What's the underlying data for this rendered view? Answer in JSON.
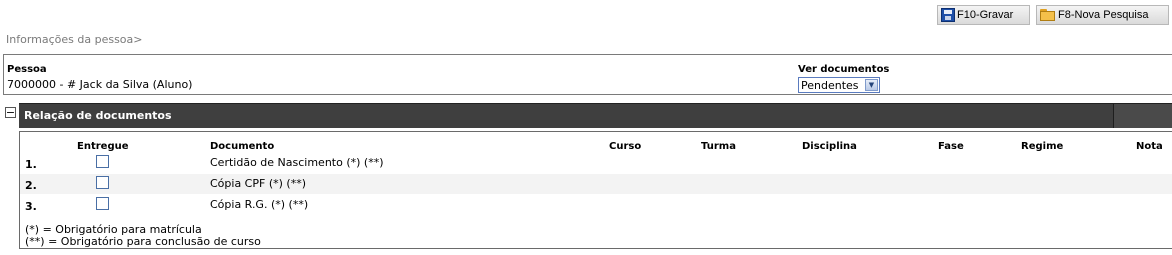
{
  "toolbar": {
    "save_label": "F10-Gravar",
    "search_label": "F8-Nova Pesquisa",
    "save_icon": "floppy-disk-icon",
    "search_icon": "folder-icon"
  },
  "breadcrumb": "Informações da pessoa>",
  "person": {
    "label": "Pessoa",
    "value": "7000000 - # Jack da Silva (Aluno)",
    "docs_label": "Ver documentos",
    "docs_selected": "Pendentes"
  },
  "section": {
    "title": "Relação de documentos",
    "collapse_symbol": "−"
  },
  "table": {
    "headers": {
      "entregue": "Entregue",
      "documento": "Documento",
      "curso": "Curso",
      "turma": "Turma",
      "disciplina": "Disciplina",
      "fase": "Fase",
      "regime": "Regime",
      "nota": "Nota"
    },
    "rows": [
      {
        "num": "1.",
        "documento": "Certidão de Nascimento  (*)  (**)",
        "entregue": false
      },
      {
        "num": "2.",
        "documento": "Cópia CPF  (*)  (**)",
        "entregue": false
      },
      {
        "num": "3.",
        "documento": "Cópia R.G.  (*)  (**)",
        "entregue": false
      }
    ]
  },
  "notes": {
    "line1": "(*) = Obrigatório para matrícula",
    "line2": "(**) = Obrigatório para conclusão de curso"
  },
  "colors": {
    "header_bg": "#3f3f3f",
    "checkbox_border": "#4a6fa5",
    "select_border": "#5a7bbf"
  }
}
